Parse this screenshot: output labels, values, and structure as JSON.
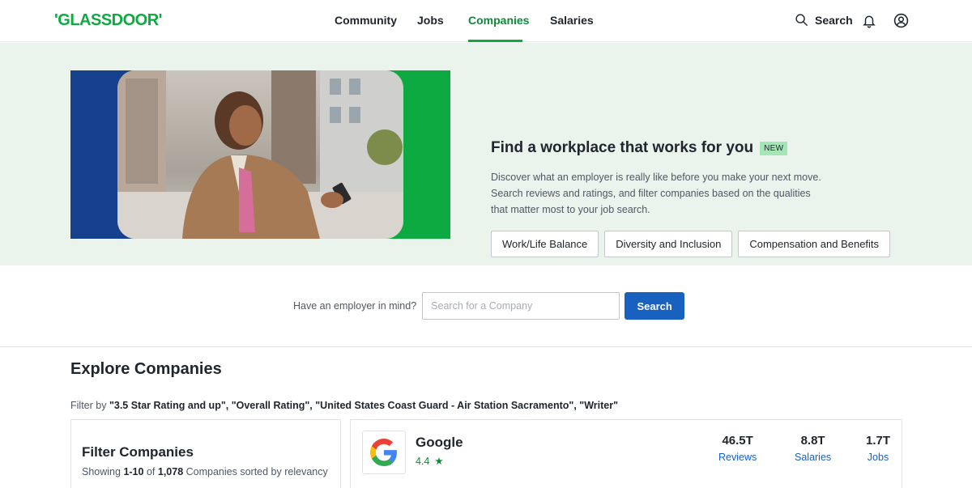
{
  "header": {
    "logo": "'GLASSDOOR'",
    "nav": [
      "Community",
      "Jobs",
      "Companies",
      "Salaries"
    ],
    "active_nav": "Companies",
    "search_label": "Search",
    "accent_color": "#0caa41"
  },
  "hero": {
    "title": "Find a workplace that works for you",
    "badge": "NEW",
    "description": "Discover what an employer is really like before you make your next move. Search reviews and ratings, and filter companies based on the qualities that matter most to your job search.",
    "chips": [
      "Work/Life Balance",
      "Diversity and Inclusion",
      "Compensation and Benefits"
    ]
  },
  "employer_search": {
    "label": "Have an employer in mind?",
    "placeholder": "Search for a Company",
    "button": "Search"
  },
  "explore": {
    "title": "Explore Companies",
    "filter_prefix": "Filter by",
    "filter_values": "\"3.5 Star Rating and up\", \"Overall Rating\", \"United States Coast Guard - Air Station Sacramento\", \"Writer\""
  },
  "filter_panel": {
    "title": "Filter Companies",
    "showing_prefix": "Showing",
    "range": "1-10",
    "of": "of",
    "total": "1,078",
    "suffix": "Companies sorted by relevancy"
  },
  "company": {
    "name": "Google",
    "rating": "4.4",
    "stats": [
      {
        "value": "46.5T",
        "label": "Reviews"
      },
      {
        "value": "8.8T",
        "label": "Salaries"
      },
      {
        "value": "1.7T",
        "label": "Jobs"
      }
    ]
  }
}
